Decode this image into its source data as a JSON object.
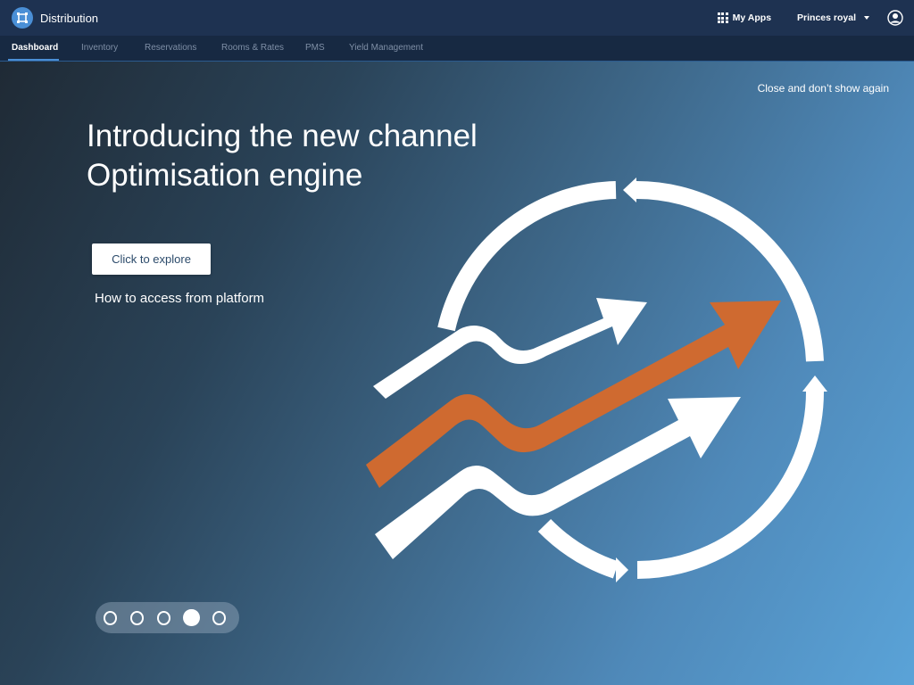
{
  "header": {
    "app_title": "Distribution",
    "my_apps_label": "My Apps",
    "property_label": "Princes royal"
  },
  "nav": {
    "tabs": [
      {
        "label": "Dashboard",
        "active": true
      },
      {
        "label": "Inventory",
        "active": false
      },
      {
        "label": "Reservations",
        "active": false
      },
      {
        "label": "Rooms & Rates",
        "active": false
      },
      {
        "label": "PMS",
        "active": false
      },
      {
        "label": "Yield Management",
        "active": false
      }
    ]
  },
  "hero": {
    "close_label": "Close and don’t show again",
    "title": "Introducing the new channel Optimisation engine",
    "explore_button": "Click to explore",
    "access_link": "How to access from platform",
    "slides": {
      "count": 5,
      "active_index": 4
    }
  },
  "colors": {
    "header_bg": "#1e3251",
    "nav_bg": "#172942",
    "accent_blue": "#4a8fd6",
    "arrow_orange": "#cf6a30",
    "arrow_white": "#ffffff"
  },
  "icons": {
    "brand": "distribution-logo-icon",
    "apps": "grid-icon",
    "dropdown": "caret-down-icon",
    "account": "user-circle-icon"
  }
}
